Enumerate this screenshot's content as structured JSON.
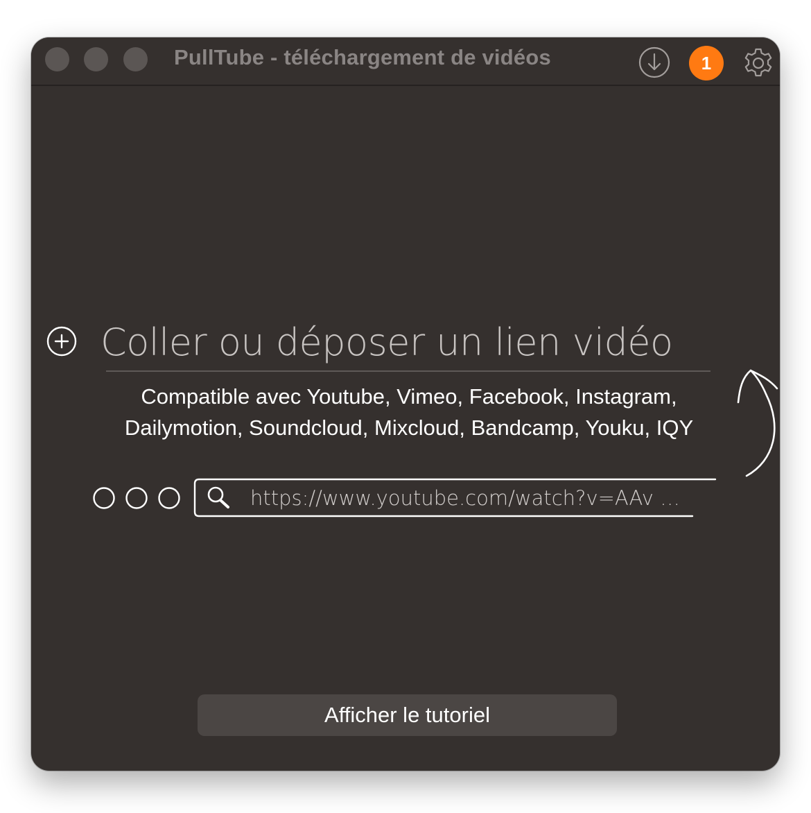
{
  "window": {
    "title": "PullTube - téléchargement de vidéos"
  },
  "titlebar": {
    "download_icon": "download-circle-icon",
    "badge_count": "1",
    "badge_color": "#ff7a12",
    "settings_icon": "gear-icon"
  },
  "main": {
    "drop_placeholder": "Coller ou déposer un lien vidéo",
    "add_icon": "plus-circle-icon",
    "compat_line1": "Compatible avec Youtube, Vimeo, Facebook, Instagram,",
    "compat_line2": "Dailymotion, Soundcloud, Mixcloud, Bandcamp, Youku, IQY",
    "url_example": "https://www.youtube.com/watch?v=AAv …",
    "tutorial_button": "Afficher le tutoriel"
  },
  "colors": {
    "window_bg": "#35302e",
    "accent": "#ff7a12",
    "button_bg": "#4b4644"
  }
}
